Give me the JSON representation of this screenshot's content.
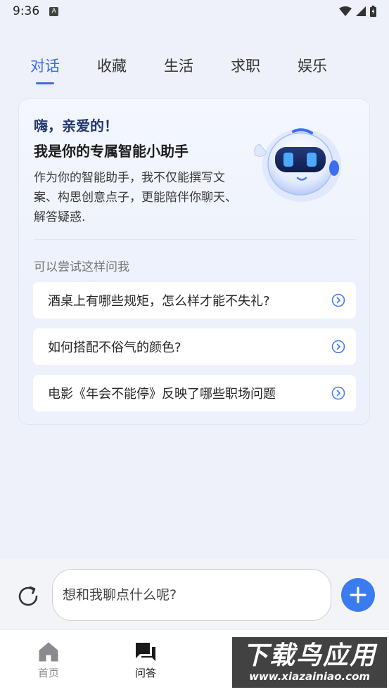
{
  "status": {
    "time": "9:36",
    "notif": "A"
  },
  "tabs": [
    {
      "label": "对话",
      "active": true
    },
    {
      "label": "收藏"
    },
    {
      "label": "生活"
    },
    {
      "label": "求职"
    },
    {
      "label": "娱乐"
    }
  ],
  "card": {
    "greet": "嗨，亲爱的！",
    "headline": "我是你的专属智能小助手",
    "intro": "作为你的智能助手，我不仅能撰写文案、构思创意点子，更能陪伴你聊天、解答疑惑.",
    "try_label": "可以尝试这样问我",
    "suggestions": [
      "酒桌上有哪些规矩，怎么样才能不失礼?",
      "如何搭配不俗气的颜色?",
      "电影《年会不能停》反映了哪些职场问题"
    ]
  },
  "input": {
    "placeholder": "想和我聊点什么呢?"
  },
  "nav": {
    "home": "首页",
    "qa": "问答"
  },
  "watermark": {
    "title": "下载鸟应用",
    "url": "www.xiazainiao.com"
  },
  "colors": {
    "accent": "#3a6de9",
    "add_button": "#3a7bef",
    "background": "#eef1f9"
  }
}
